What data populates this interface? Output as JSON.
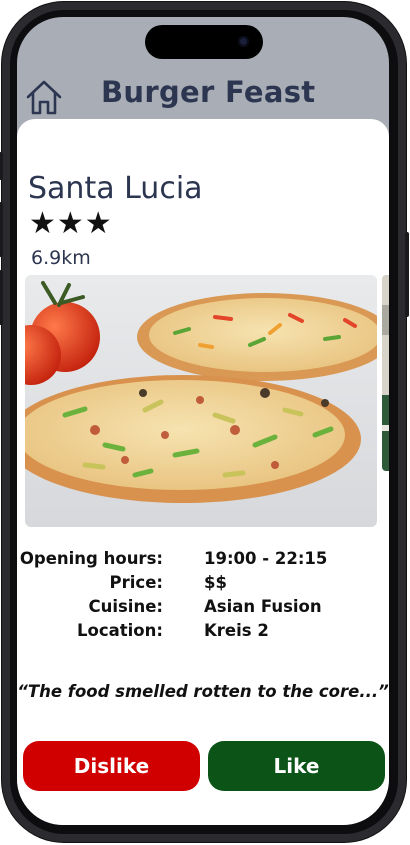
{
  "header": {
    "title": "Burger Feast",
    "home_icon": "home-icon"
  },
  "restaurant": {
    "name": "Santa Lucia",
    "stars": "★★★",
    "rating": 3,
    "distance": "6.9km"
  },
  "details": [
    {
      "label": "Opening hours:",
      "value": "19:00 - 22:15"
    },
    {
      "label": "Price:",
      "value": "$$"
    },
    {
      "label": "Cuisine:",
      "value": "Asian Fusion"
    },
    {
      "label": "Location:",
      "value": "Kreis 2"
    }
  ],
  "review": {
    "quote": "“The food smelled rotten to the core...”"
  },
  "actions": {
    "dislike_label": "Dislike",
    "like_label": "Like"
  },
  "colors": {
    "header_bg": "#a9aeb6",
    "title": "#2d3650",
    "dislike": "#d10000",
    "like": "#0b5317"
  }
}
